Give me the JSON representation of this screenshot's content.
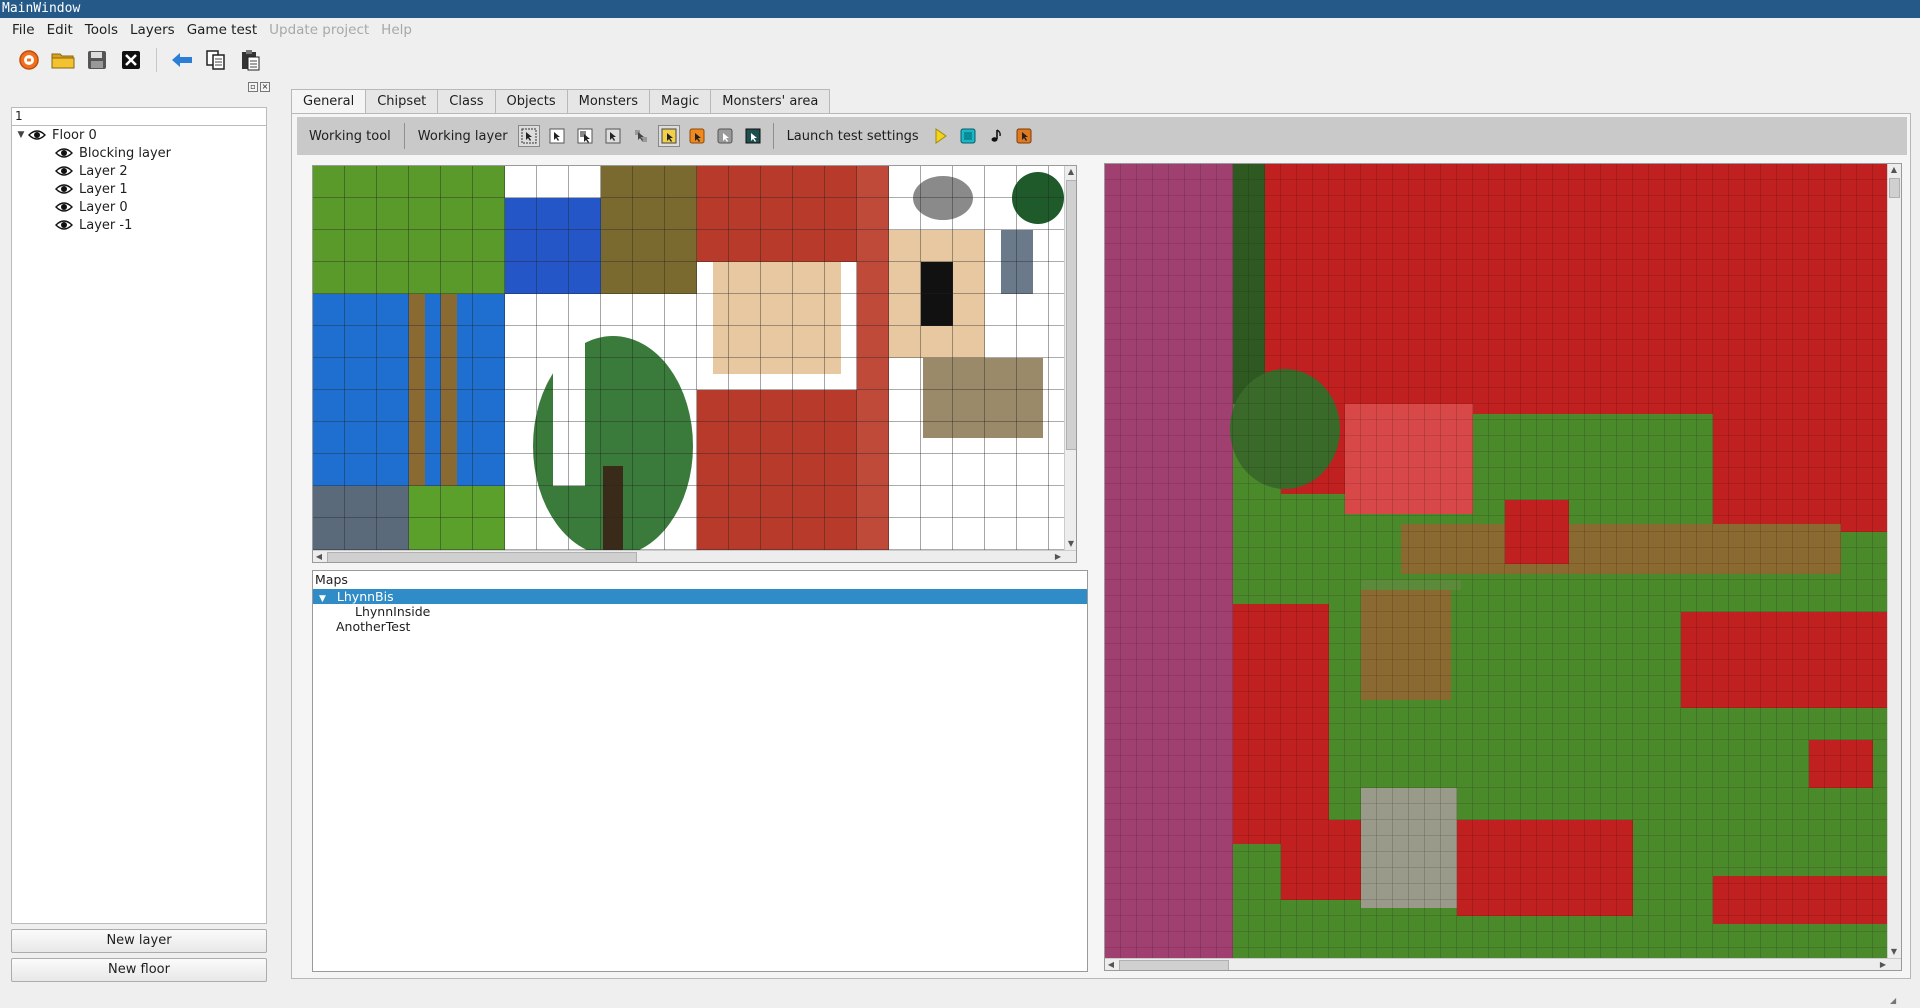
{
  "window": {
    "title": "MainWindow"
  },
  "menu": [
    {
      "label": "File",
      "enabled": true
    },
    {
      "label": "Edit",
      "enabled": true
    },
    {
      "label": "Tools",
      "enabled": true
    },
    {
      "label": "Layers",
      "enabled": true
    },
    {
      "label": "Game test",
      "enabled": true
    },
    {
      "label": "Update project",
      "enabled": false
    },
    {
      "label": "Help",
      "enabled": false
    }
  ],
  "toolbar": {
    "icons": [
      "new-project-icon",
      "open-folder-icon",
      "save-icon",
      "close-project-icon",
      "undo-icon",
      "copy-icon",
      "paste-icon"
    ]
  },
  "layers_panel": {
    "input_value": "1",
    "floor": "Floor 0",
    "layers": [
      "Blocking layer",
      "Layer 2",
      "Layer 1",
      "Layer 0",
      "Layer -1"
    ],
    "new_layer_label": "New layer",
    "new_floor_label": "New floor"
  },
  "tabs": [
    "General",
    "Chipset",
    "Class",
    "Objects",
    "Monsters",
    "Magic",
    "Monsters' area"
  ],
  "active_tab": "General",
  "tools_bar": {
    "working_tool_label": "Working tool",
    "working_layer_label": "Working layer",
    "launch_label": "Launch test settings"
  },
  "maps": {
    "header": "Maps",
    "items": [
      {
        "label": "LhynnBis",
        "selected": true,
        "expanded": true,
        "children": [
          "LhynnInside"
        ]
      },
      {
        "label": "AnotherTest",
        "selected": false
      }
    ]
  },
  "colors": {
    "title_bar": "#255a88",
    "selection": "#308cc6",
    "tool_bar_bg": "#c9c9c9",
    "grass": "#4a8a2a",
    "roof": "#c02020",
    "water": "#1e6fd0",
    "path": "#8a6a30",
    "pink_cobble": "#a04070"
  }
}
